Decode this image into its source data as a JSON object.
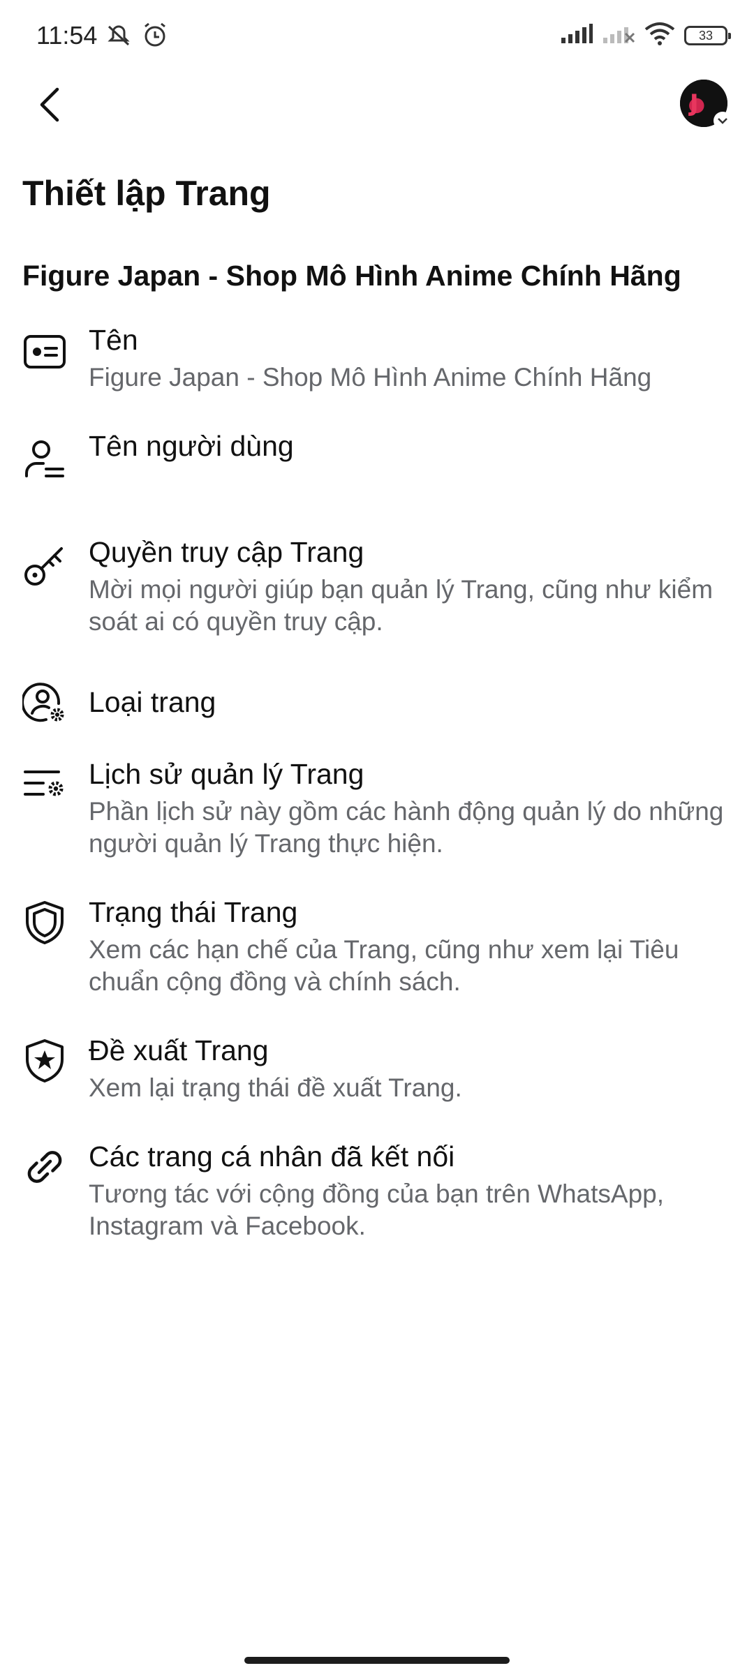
{
  "status_bar": {
    "time": "11:54",
    "battery": "33",
    "icons": [
      "mute-icon",
      "alarm-icon",
      "signal-icon",
      "signal-off-icon",
      "wifi-icon",
      "battery-icon"
    ]
  },
  "header": {
    "back_icon": "chevron-left-icon",
    "avatar_text": "J"
  },
  "page_title": "Thiết lập Trang",
  "section_title": "Figure Japan - Shop Mô Hình Anime Chính Hãng",
  "items": [
    {
      "icon": "id-card-icon",
      "label": "Tên",
      "desc": "Figure Japan - Shop Mô Hình Anime Chính Hãng"
    },
    {
      "icon": "user-list-icon",
      "label": "Tên người dùng",
      "desc": ""
    },
    {
      "icon": "key-icon",
      "label": "Quyền truy cập Trang",
      "desc": "Mời mọi người giúp bạn quản lý Trang, cũng như kiểm soát ai có quyền truy cập."
    },
    {
      "icon": "person-gear-icon",
      "label": "Loại trang",
      "desc": ""
    },
    {
      "icon": "list-gear-icon",
      "label": "Lịch sử quản lý Trang",
      "desc": "Phần lịch sử này gồm các hành động quản lý do những người quản lý Trang thực hiện."
    },
    {
      "icon": "shield-icon",
      "label": "Trạng thái Trang",
      "desc": "Xem các hạn chế của Trang, cũng như xem lại Tiêu chuẩn cộng đồng và chính sách."
    },
    {
      "icon": "shield-star-icon",
      "label": "Đề xuất Trang",
      "desc": "Xem lại trạng thái đề xuất Trang."
    },
    {
      "icon": "link-icon",
      "label": "Các trang cá nhân đã kết nối",
      "desc": "Tương tác với cộng đồng của bạn trên WhatsApp, Instagram và Facebook."
    }
  ]
}
